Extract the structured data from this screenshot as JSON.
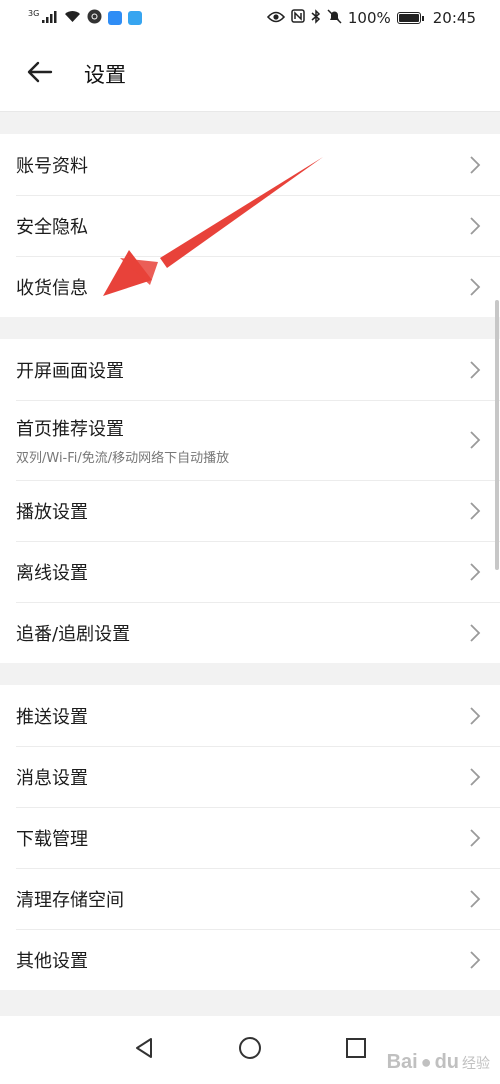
{
  "status_bar": {
    "network": "3G",
    "battery_text": "100%",
    "time": "20:45",
    "icons": [
      "signal-icon",
      "wifi-icon",
      "chrome-icon",
      "cloud-icon",
      "search-app-icon",
      "eye-icon",
      "nfc-icon",
      "bluetooth-icon",
      "mute-icon",
      "battery-icon"
    ]
  },
  "header": {
    "title": "设置",
    "back_icon": "back-arrow-icon"
  },
  "groups": [
    {
      "items": [
        {
          "label": "账号资料"
        },
        {
          "label": "安全隐私"
        },
        {
          "label": "收货信息"
        }
      ]
    },
    {
      "items": [
        {
          "label": "开屏画面设置"
        },
        {
          "label": "首页推荐设置",
          "sub": "双列/Wi-Fi/免流/移动网络下自动播放"
        },
        {
          "label": "播放设置"
        },
        {
          "label": "离线设置"
        },
        {
          "label": "追番/追剧设置"
        }
      ]
    },
    {
      "items": [
        {
          "label": "推送设置"
        },
        {
          "label": "消息设置"
        },
        {
          "label": "下载管理"
        },
        {
          "label": "清理存储空间"
        },
        {
          "label": "其他设置"
        }
      ]
    }
  ],
  "annotation": {
    "color": "#e8423a",
    "points_to": "收货信息"
  },
  "nav_bar": {
    "icons": [
      "nav-back-icon",
      "nav-home-icon",
      "nav-recents-icon"
    ]
  },
  "watermark": {
    "brand": "Bai",
    "brand_end": "du",
    "sub": "经验"
  }
}
